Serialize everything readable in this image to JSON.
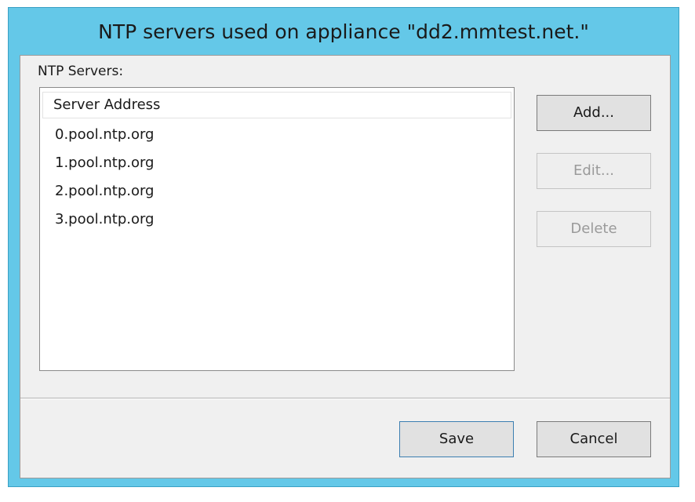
{
  "window": {
    "title": "NTP servers used on appliance \"dd2.mmtest.net.\""
  },
  "group": {
    "label": "NTP Servers:"
  },
  "list": {
    "column_header": "Server Address",
    "rows": [
      "0.pool.ntp.org",
      "1.pool.ntp.org",
      "2.pool.ntp.org",
      "3.pool.ntp.org"
    ]
  },
  "buttons": {
    "add": "Add...",
    "edit": "Edit...",
    "delete": "Delete",
    "save": "Save",
    "cancel": "Cancel"
  },
  "colors": {
    "titlebar": "#64c8e8",
    "client_background": "#f0f0f0",
    "default_button_border": "#3c7fb1",
    "disabled_text": "#9a9a9a"
  }
}
